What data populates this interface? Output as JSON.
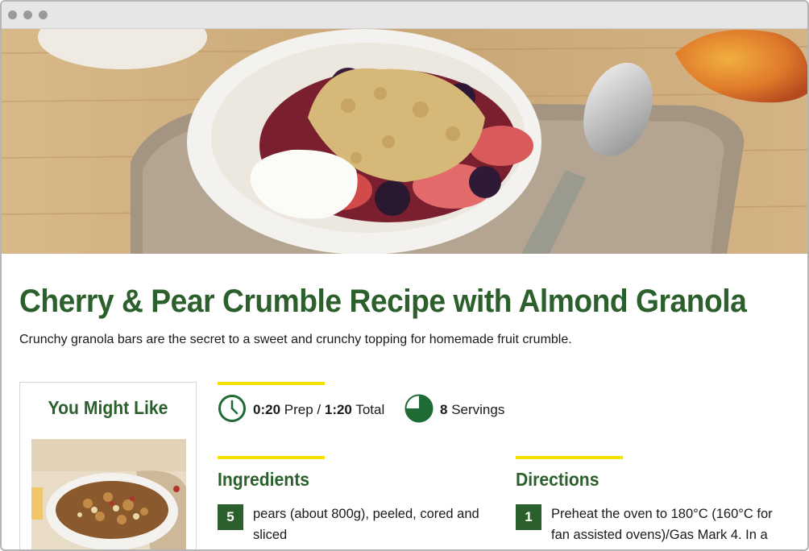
{
  "window": {
    "controls": [
      "close",
      "minimize",
      "maximize"
    ]
  },
  "hero": {
    "image": "cherry-pear-crumble-bowl-photo"
  },
  "recipe": {
    "title": "Cherry & Pear Crumble Recipe with Almond Granola",
    "description": "Crunchy granola bars are the secret to a sweet and crunchy topping for homemade fruit crumble.",
    "prep_time": "0:20",
    "prep_label": "Prep /",
    "total_time": "1:20",
    "total_label": "Total",
    "servings": "8",
    "servings_label": "Servings"
  },
  "sidebar": {
    "title": "You Might Like",
    "image": "granola-bowl-photo"
  },
  "ingredients": {
    "heading": "Ingredients",
    "items": [
      {
        "qty": "5",
        "text": "pears (about 800g), peeled, cored and sliced"
      }
    ]
  },
  "directions": {
    "heading": "Directions",
    "steps": [
      {
        "num": "1",
        "text": "Preheat the oven to 180°C (160°C for fan assisted ovens)/Gas Mark 4. In a"
      }
    ]
  },
  "colors": {
    "brand_green": "#2b5f2b",
    "accent_yellow": "#f5e100",
    "icon_green": "#1f6b35"
  },
  "icons": {
    "time": "clock-icon",
    "servings": "pie-servings-icon"
  }
}
